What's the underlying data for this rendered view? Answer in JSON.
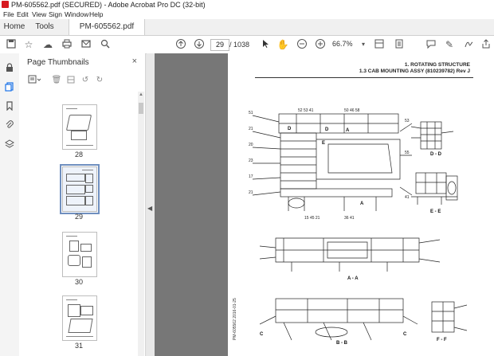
{
  "window": {
    "title": "PM-605562.pdf (SECURED) - Adobe Acrobat Pro DC (32-bit)"
  },
  "menu": {
    "items": [
      "File",
      "Edit",
      "View",
      "Sign",
      "Window",
      "Help"
    ]
  },
  "tabs": {
    "home": "Home",
    "tools": "Tools",
    "document": "PM-605562.pdf (SE...",
    "close": "×"
  },
  "toolbar": {
    "current_page": "29",
    "page_count": "/ 1038",
    "zoom": "66.7%"
  },
  "panel": {
    "title": "Page Thumbnails",
    "close": "×",
    "thumbnails": [
      {
        "label": "28",
        "selected": false
      },
      {
        "label": "29",
        "selected": true
      },
      {
        "label": "30",
        "selected": false
      },
      {
        "label": "31",
        "selected": false
      }
    ]
  },
  "page": {
    "heading1": "1. ROTATING STRUCTURE",
    "heading2": "1.3 CAB MOUNTING ASSY (810239782) Rev J",
    "side_code": "PM-605562 2016-01-25",
    "view_labels": [
      "D - D",
      "E - E",
      "A - A",
      "B - B",
      "F - F"
    ]
  },
  "colors": {
    "acrobat_red": "#d71920",
    "accent_blue": "#1a73e8",
    "doc_bg": "#777777"
  }
}
